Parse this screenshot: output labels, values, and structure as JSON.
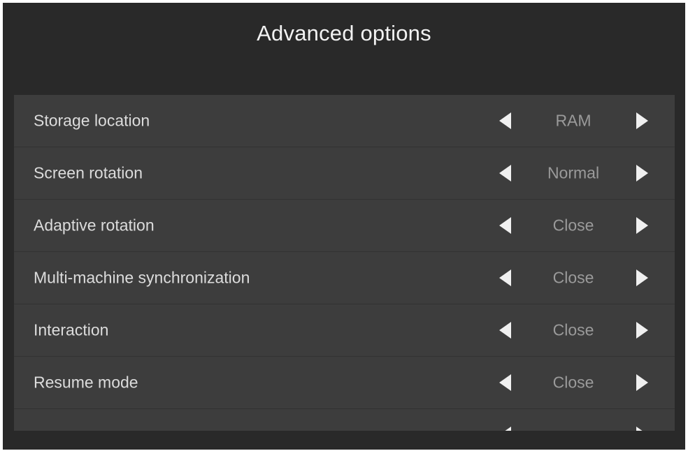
{
  "title": "Advanced options",
  "options": [
    {
      "label": "Storage location",
      "value": "RAM"
    },
    {
      "label": "Screen rotation",
      "value": "Normal"
    },
    {
      "label": "Adaptive rotation",
      "value": "Close"
    },
    {
      "label": "Multi-machine synchronization",
      "value": "Close"
    },
    {
      "label": "Interaction",
      "value": "Close"
    },
    {
      "label": "Resume mode",
      "value": "Close"
    }
  ],
  "icons": {
    "previous": "triangle-left-icon",
    "next": "triangle-right-icon"
  },
  "colors": {
    "background": "#292929",
    "panel": "#3d3d3d",
    "label": "#dcdcdc",
    "value": "#9a9a9a",
    "arrow": "#f0f0f0"
  }
}
